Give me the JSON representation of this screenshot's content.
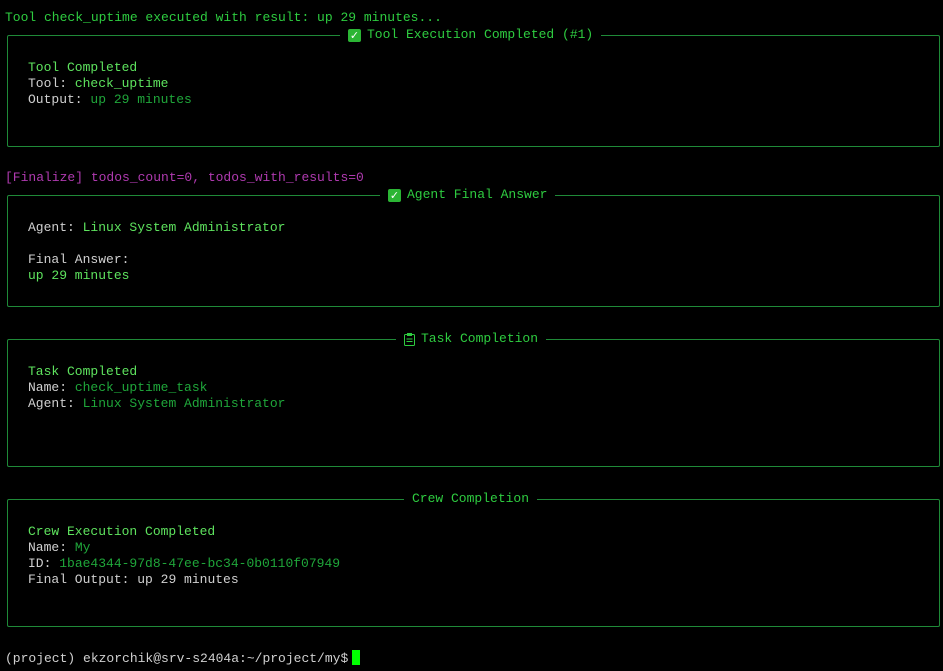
{
  "log_line": "Tool check_uptime executed with result: up 29 minutes...",
  "tool_panel": {
    "title": "Tool Execution Completed (#1)",
    "heading": "Tool Completed",
    "tool_label": "Tool:",
    "tool_value": "check_uptime",
    "output_label": "Output:",
    "output_value": "up 29 minutes"
  },
  "finalize_line": "[Finalize] todos_count=0, todos_with_results=0",
  "answer_panel": {
    "title": "Agent Final Answer",
    "agent_label": "Agent:",
    "agent_value": "Linux System Administrator",
    "final_label": "Final Answer:",
    "final_value": "up 29 minutes"
  },
  "task_panel": {
    "title": "Task Completion",
    "heading": "Task Completed",
    "name_label": "Name:",
    "name_value": "check_uptime_task",
    "agent_label": "Agent:",
    "agent_value": "Linux System Administrator"
  },
  "crew_panel": {
    "title": "Crew Completion",
    "heading": "Crew Execution Completed",
    "name_label": "Name:",
    "name_value": "My",
    "id_label": "ID:",
    "id_value": "1bae4344-97d8-47ee-bc34-0b0110f07949",
    "output_label": "Final Output:",
    "output_value": "up 29 minutes"
  },
  "prompt": "(project) ekzorchik@srv-s2404a:~/project/my$",
  "icons": {
    "check": "check-mark-icon",
    "clipboard": "clipboard-icon"
  },
  "colors": {
    "background": "#000000",
    "border": "#1f8a38",
    "accent": "#2ecc40",
    "magenta": "#b03ab0",
    "cursor": "#00ff00"
  }
}
